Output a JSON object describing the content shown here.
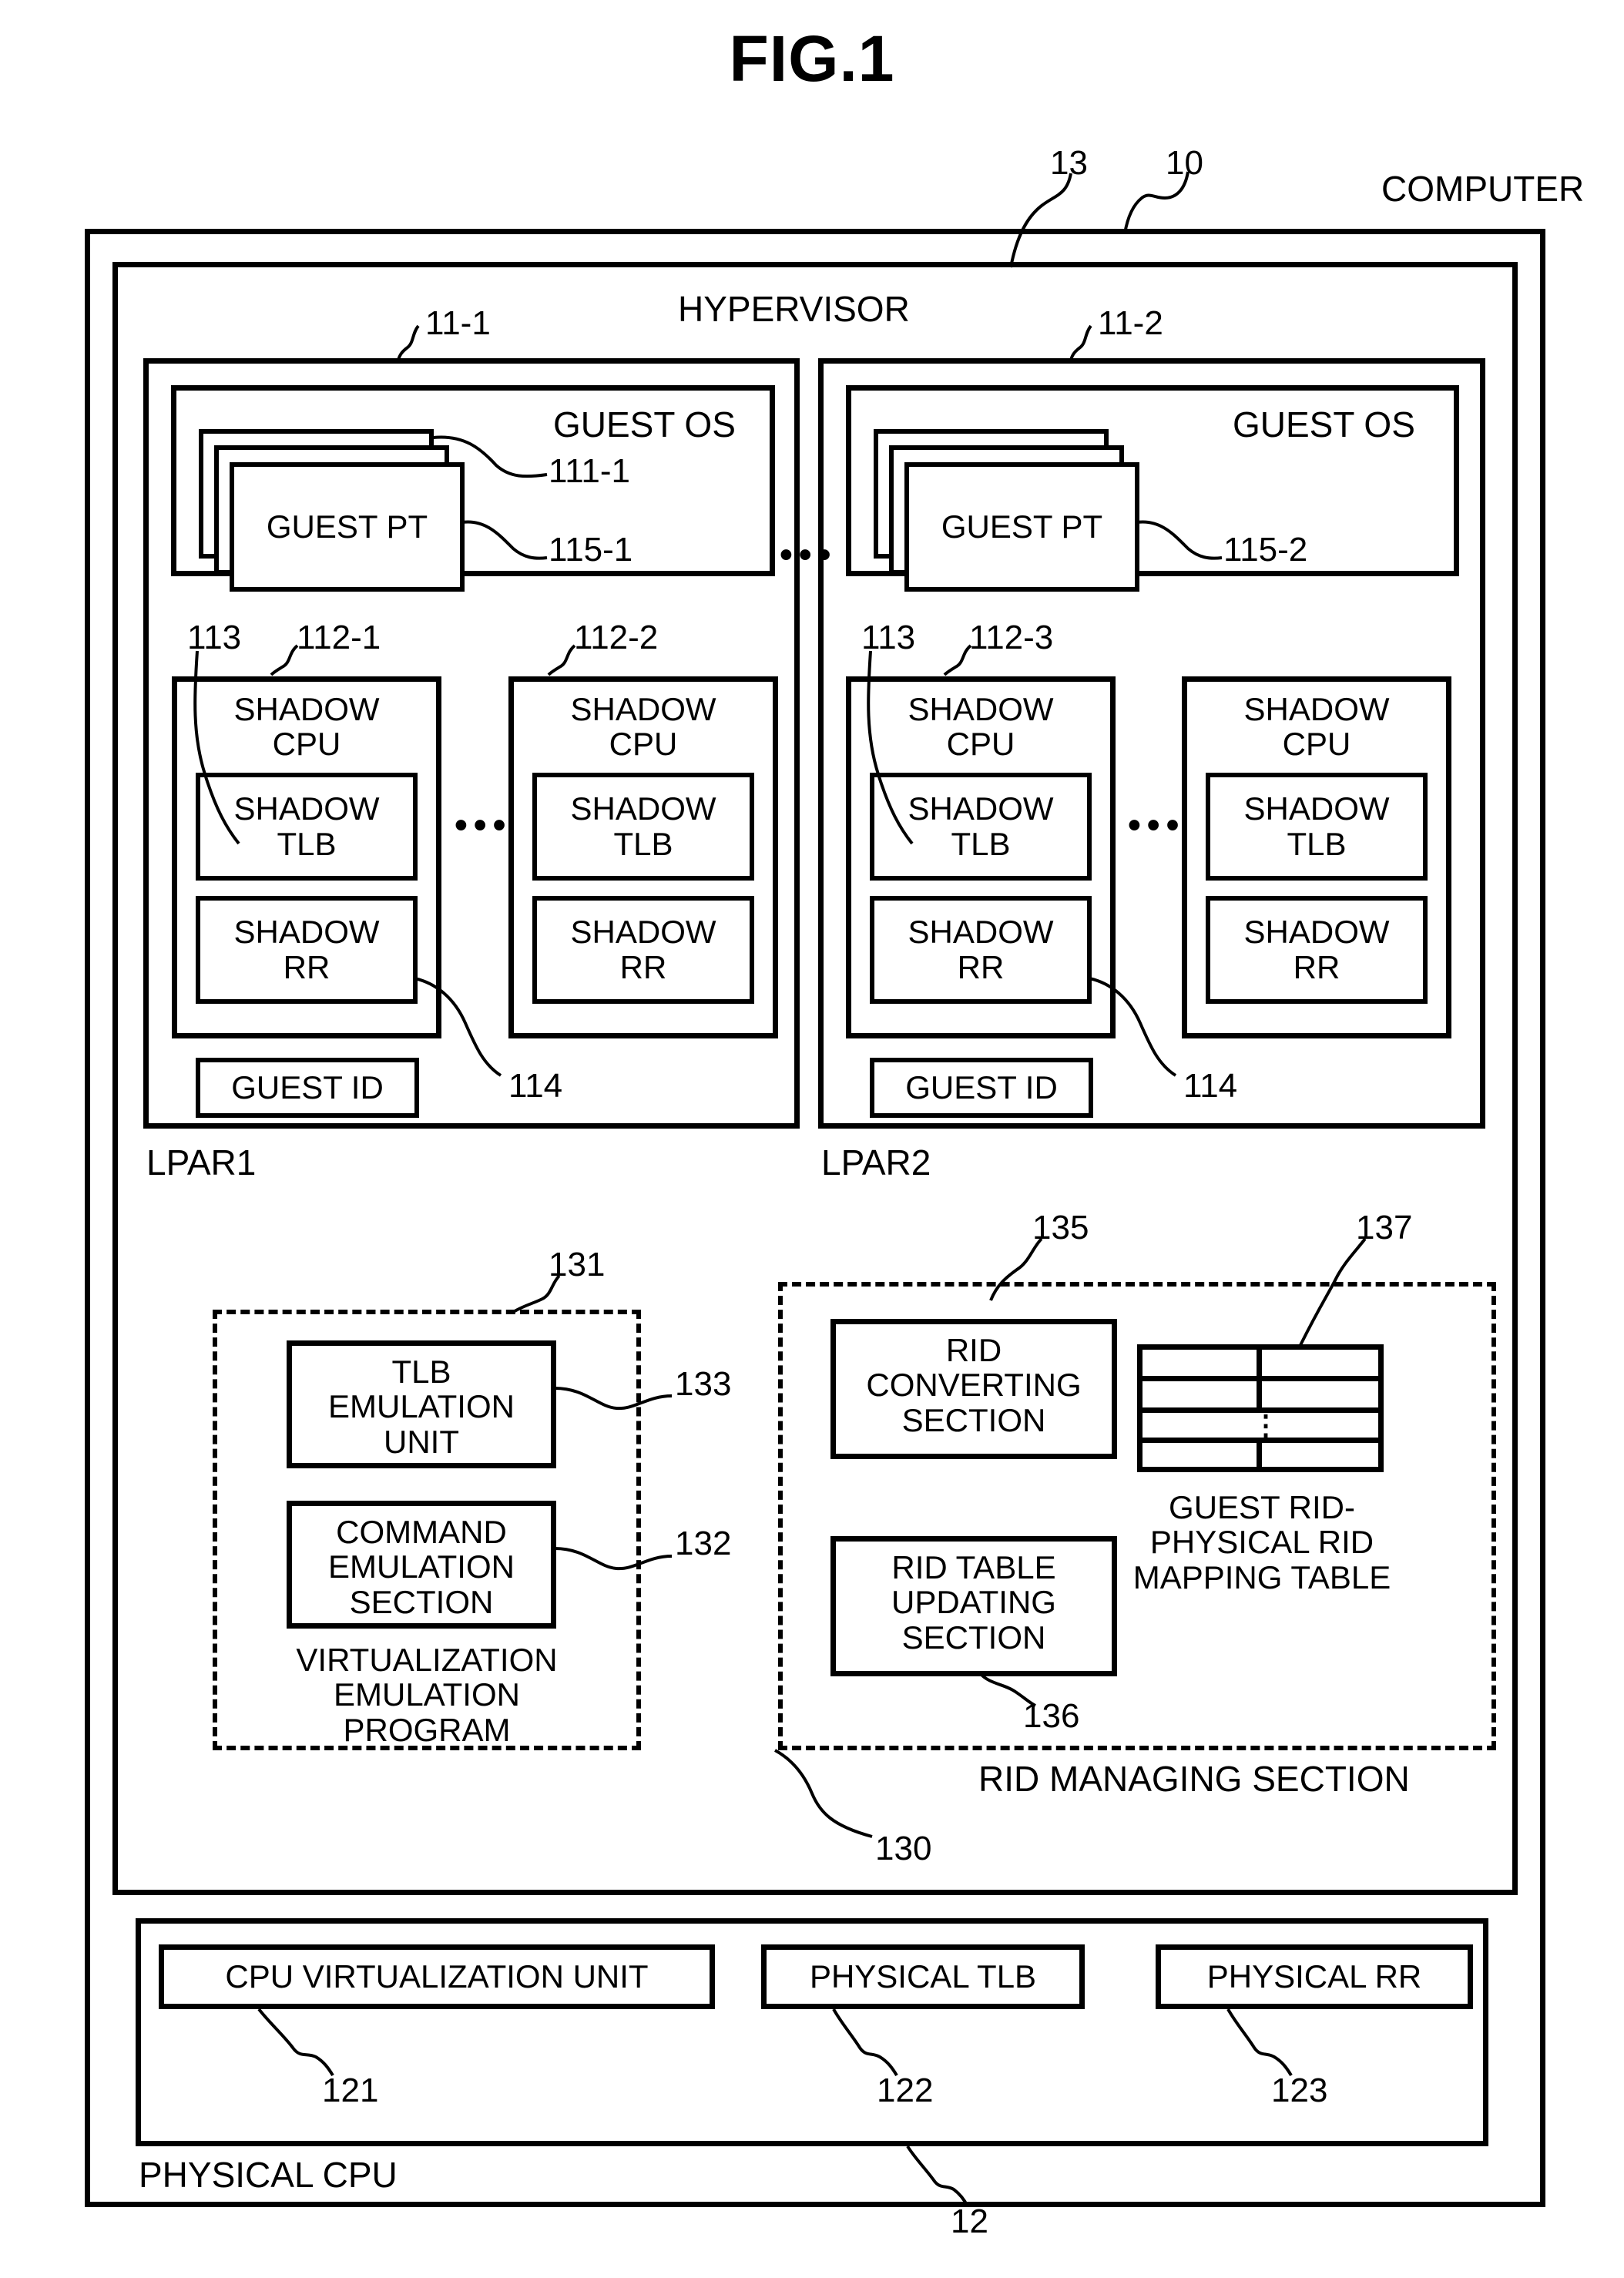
{
  "figure": {
    "title": "FIG.1"
  },
  "computer": {
    "label": "COMPUTER",
    "ref": "10"
  },
  "hypervisor": {
    "label": "HYPERVISOR",
    "ref": "13"
  },
  "lpars": [
    {
      "name": "LPAR1",
      "ref": "11-1",
      "guest_os": {
        "label": "GUEST OS",
        "ref": "111-1",
        "guest_pt": {
          "label": "GUEST PT",
          "ref": "115-1"
        }
      },
      "shadow_cpu_group_ref": "112-1",
      "shadow_tlb_ref": "113",
      "shadow_rr_ref": "114",
      "second_cpu_ref": "112-2",
      "shadow_cpus": [
        {
          "title": "SHADOW\nCPU",
          "tlb": "SHADOW\nTLB",
          "rr": "SHADOW\nRR"
        },
        {
          "title": "SHADOW\nCPU",
          "tlb": "SHADOW\nTLB",
          "rr": "SHADOW\nRR"
        }
      ],
      "guest_id": "GUEST ID",
      "cpu_ellipsis": "•••"
    },
    {
      "name": "LPAR2",
      "ref": "11-2",
      "guest_os": {
        "label": "GUEST OS",
        "ref": "",
        "guest_pt": {
          "label": "GUEST PT",
          "ref": "115-2"
        }
      },
      "shadow_cpu_group_ref": "112-3",
      "shadow_tlb_ref": "113",
      "shadow_rr_ref": "114",
      "shadow_cpus": [
        {
          "title": "SHADOW\nCPU",
          "tlb": "SHADOW\nTLB",
          "rr": "SHADOW\nRR"
        },
        {
          "title": "SHADOW\nCPU",
          "tlb": "SHADOW\nTLB",
          "rr": "SHADOW\nRR"
        }
      ],
      "guest_id": "GUEST ID",
      "cpu_ellipsis": "•••"
    }
  ],
  "lpar_ellipsis": "•••",
  "virtualization_program": {
    "ref": "131",
    "caption_line1": "VIRTUALIZATION",
    "caption_line2": "EMULATION",
    "caption_line3": "PROGRAM",
    "units": [
      {
        "line1": "TLB",
        "line2": "EMULATION",
        "line3": "UNIT",
        "ref": "133"
      },
      {
        "line1": "COMMAND",
        "line2": "EMULATION",
        "line3": "SECTION",
        "ref": "132"
      }
    ]
  },
  "rid_managing_section": {
    "caption": "RID MANAGING SECTION",
    "ref": "130",
    "units": [
      {
        "line1": "RID",
        "line2": "CONVERTING",
        "line3": "SECTION",
        "ref": "135"
      },
      {
        "line1": "RID TABLE",
        "line2": "UPDATING",
        "line3": "SECTION",
        "ref": "136"
      }
    ],
    "mapping_table": {
      "ref": "137",
      "caption_line1": "GUEST RID-",
      "caption_line2": "PHYSICAL RID",
      "caption_line3": "MAPPING TABLE",
      "rows": 4,
      "columns": 2,
      "ellipsis_row_index": 2,
      "vertical_ellipsis": "⋮"
    }
  },
  "physical_cpu": {
    "label": "PHYSICAL CPU",
    "ref": "12",
    "units": [
      {
        "label": "CPU VIRTUALIZATION UNIT",
        "ref": "121"
      },
      {
        "label": "PHYSICAL TLB",
        "ref": "122"
      },
      {
        "label": "PHYSICAL RR",
        "ref": "123"
      }
    ]
  },
  "colors": {
    "ink": "#000000",
    "paper": "#ffffff"
  }
}
